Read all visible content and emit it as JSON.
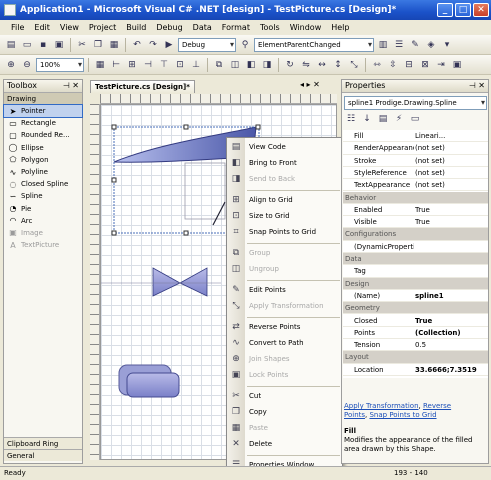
{
  "window": {
    "title": "Application1 - Microsoft Visual C# .NET [design] - TestPicture.cs [Design]*"
  },
  "menubar": [
    "File",
    "Edit",
    "View",
    "Project",
    "Build",
    "Debug",
    "Data",
    "Format",
    "Tools",
    "Window",
    "Help"
  ],
  "toolbar1": {
    "config": "Debug",
    "object_combo": "ElementParentChanged"
  },
  "toolbar2": {
    "zoom": "100%"
  },
  "toolbox": {
    "title": "Toolbox",
    "tab": "Drawing",
    "items": [
      {
        "label": "Pointer",
        "icon": "pointer-icon",
        "selected": true,
        "disabled": false
      },
      {
        "label": "Rectangle",
        "icon": "rectangle-icon",
        "selected": false,
        "disabled": false
      },
      {
        "label": "Rounded Re...",
        "icon": "rounded-rectangle-icon",
        "selected": false,
        "disabled": false
      },
      {
        "label": "Ellipse",
        "icon": "ellipse-icon",
        "selected": false,
        "disabled": false
      },
      {
        "label": "Polygon",
        "icon": "polygon-icon",
        "selected": false,
        "disabled": false
      },
      {
        "label": "Polyline",
        "icon": "polyline-icon",
        "selected": false,
        "disabled": false
      },
      {
        "label": "Closed Spline",
        "icon": "closed-spline-icon",
        "selected": false,
        "disabled": false
      },
      {
        "label": "Spline",
        "icon": "spline-icon",
        "selected": false,
        "disabled": false
      },
      {
        "label": "Pie",
        "icon": "pie-icon",
        "selected": false,
        "disabled": false
      },
      {
        "label": "Arc",
        "icon": "arc-icon",
        "selected": false,
        "disabled": false
      },
      {
        "label": "Image",
        "icon": "image-icon",
        "selected": false,
        "disabled": true
      },
      {
        "label": "TextPicture",
        "icon": "text-icon",
        "selected": false,
        "disabled": true
      }
    ],
    "bottom_tabs": [
      "Clipboard Ring",
      "General"
    ]
  },
  "document": {
    "tab": "TestPicture.cs [Design]*"
  },
  "context_menu": [
    {
      "label": "View Code",
      "icon": "view-code-icon",
      "disabled": false,
      "sep_before": false
    },
    {
      "label": "Bring to Front",
      "icon": "bring-front-icon",
      "disabled": false,
      "sep_before": false
    },
    {
      "label": "Send to Back",
      "icon": "send-back-icon",
      "disabled": true,
      "sep_before": false
    },
    {
      "label": "Align to Grid",
      "icon": "align-grid-icon",
      "disabled": false,
      "sep_before": true
    },
    {
      "label": "Size to Grid",
      "icon": "size-grid-icon",
      "disabled": false,
      "sep_before": false
    },
    {
      "label": "Snap Points to Grid",
      "icon": "snap-points-icon",
      "disabled": false,
      "sep_before": false
    },
    {
      "label": "Group",
      "icon": "group-icon",
      "disabled": true,
      "sep_before": true
    },
    {
      "label": "Ungroup",
      "icon": "ungroup-icon",
      "disabled": true,
      "sep_before": false
    },
    {
      "label": "Edit Points",
      "icon": "edit-points-icon",
      "disabled": false,
      "sep_before": true
    },
    {
      "label": "Apply Transformation",
      "icon": "apply-transform-icon",
      "disabled": true,
      "sep_before": false
    },
    {
      "label": "Reverse Points",
      "icon": "reverse-points-icon",
      "disabled": false,
      "sep_before": true
    },
    {
      "label": "Convert to Path",
      "icon": "convert-path-icon",
      "disabled": false,
      "sep_before": false
    },
    {
      "label": "Join Shapes",
      "icon": "join-shapes-icon",
      "disabled": true,
      "sep_before": false
    },
    {
      "label": "Lock Points",
      "icon": "lock-points-icon",
      "disabled": true,
      "sep_before": false
    },
    {
      "label": "Cut",
      "icon": "cut-icon",
      "disabled": false,
      "sep_before": true
    },
    {
      "label": "Copy",
      "icon": "copy-icon",
      "disabled": false,
      "sep_before": false
    },
    {
      "label": "Paste",
      "icon": "paste-icon",
      "disabled": true,
      "sep_before": false
    },
    {
      "label": "Delete",
      "icon": "delete-icon",
      "disabled": false,
      "sep_before": false
    },
    {
      "label": "Properties Window",
      "icon": "properties-icon",
      "disabled": false,
      "sep_before": true
    }
  ],
  "properties": {
    "title": "Properties",
    "object_combo": "spline1   Prodige.Drawing.Spline",
    "rows": [
      {
        "name": "Fill",
        "value": "Lineari...",
        "cat": false,
        "bold_value": false
      },
      {
        "name": "RenderAppearance",
        "value": "(not set)",
        "cat": false,
        "bold_value": false
      },
      {
        "name": "Stroke",
        "value": "(not set)",
        "cat": false,
        "bold_value": false
      },
      {
        "name": "StyleReference",
        "value": "(not set)",
        "cat": false,
        "bold_value": false
      },
      {
        "name": "TextAppearance",
        "value": "(not set)",
        "cat": false,
        "bold_value": false
      },
      {
        "name": "Behavior",
        "value": "",
        "cat": true,
        "bold_value": false
      },
      {
        "name": "Enabled",
        "value": "True",
        "cat": false,
        "bold_value": false
      },
      {
        "name": "Visible",
        "value": "True",
        "cat": false,
        "bold_value": false
      },
      {
        "name": "Configurations",
        "value": "",
        "cat": true,
        "bold_value": false
      },
      {
        "name": "(DynamicProperties)",
        "value": "",
        "cat": false,
        "bold_value": false
      },
      {
        "name": "Data",
        "value": "",
        "cat": true,
        "bold_value": false
      },
      {
        "name": "Tag",
        "value": "",
        "cat": false,
        "bold_value": false
      },
      {
        "name": "Design",
        "value": "",
        "cat": true,
        "bold_value": false
      },
      {
        "name": "(Name)",
        "value": "spline1",
        "cat": false,
        "bold_value": true
      },
      {
        "name": "Geometry",
        "value": "",
        "cat": true,
        "bold_value": false
      },
      {
        "name": "Closed",
        "value": "True",
        "cat": false,
        "bold_value": true
      },
      {
        "name": "Points",
        "value": "(Collection)",
        "cat": false,
        "bold_value": true
      },
      {
        "name": "Tension",
        "value": "0.5",
        "cat": false,
        "bold_value": false
      },
      {
        "name": "Layout",
        "value": "",
        "cat": true,
        "bold_value": false
      },
      {
        "name": "Location",
        "value": "33.6666;7.3519",
        "cat": false,
        "bold_value": true
      }
    ],
    "links": [
      "Apply Transformation",
      "Reverse",
      "Points",
      "Snap Points to Grid"
    ],
    "desc_title": "Fill",
    "desc_text": "Modifies the appearance of the filled area drawn by this Shape."
  },
  "status": {
    "text": "Ready",
    "coords": "193 - 140"
  }
}
